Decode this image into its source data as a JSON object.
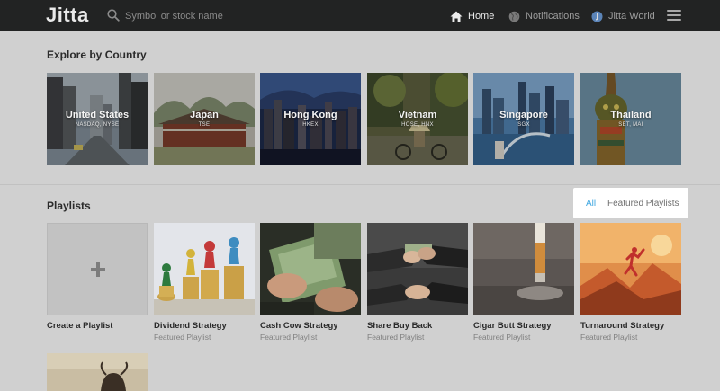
{
  "header": {
    "logo": "Jitta",
    "search_placeholder": "Symbol or stock name",
    "nav": {
      "home": "Home",
      "notifications": "Notifications",
      "jitta_world": "Jitta World"
    }
  },
  "explore": {
    "title": "Explore by Country",
    "countries": [
      {
        "name": "United States",
        "markets": "NASDAQ, NYSE"
      },
      {
        "name": "Japan",
        "markets": "TSE"
      },
      {
        "name": "Hong Kong",
        "markets": "HKEX"
      },
      {
        "name": "Vietnam",
        "markets": "HOSE, HNX"
      },
      {
        "name": "Singapore",
        "markets": "SGX"
      },
      {
        "name": "Thailand",
        "markets": "SET, MAI"
      }
    ]
  },
  "playlists": {
    "title": "Playlists",
    "filters": {
      "all": "All",
      "featured": "Featured Playlists"
    },
    "create_label": "Create a Playlist",
    "items": [
      {
        "title": "Dividend Strategy",
        "subtitle": "Featured Playlist"
      },
      {
        "title": "Cash Cow Strategy",
        "subtitle": "Featured Playlist"
      },
      {
        "title": "Share Buy Back",
        "subtitle": "Featured Playlist"
      },
      {
        "title": "Cigar Butt Strategy",
        "subtitle": "Featured Playlist"
      },
      {
        "title": "Turnaround Strategy",
        "subtitle": "Featured Playlist"
      }
    ]
  },
  "colors": {
    "topbar": "#222323",
    "page_background": "#d0d0d0",
    "accent": "#3fa7e0"
  }
}
